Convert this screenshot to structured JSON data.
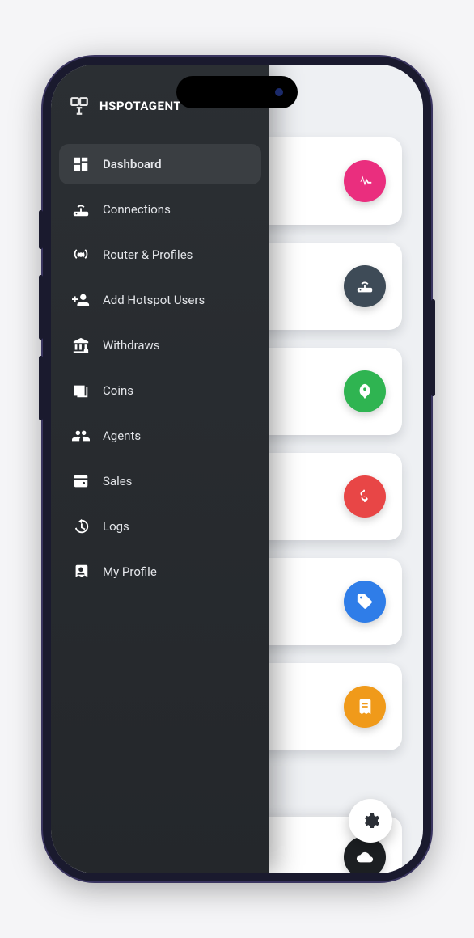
{
  "brand": {
    "title": "HSPOTAGENT"
  },
  "nav": {
    "items": [
      {
        "label": "Dashboard",
        "icon": "dashboard-icon",
        "active": true
      },
      {
        "label": "Connections",
        "icon": "router-icon",
        "active": false
      },
      {
        "label": "Router & Profiles",
        "icon": "broadcast-icon",
        "active": false
      },
      {
        "label": "Add Hotspot Users",
        "icon": "person-add-icon",
        "active": false
      },
      {
        "label": "Withdraws",
        "icon": "bank-icon",
        "active": false
      },
      {
        "label": "Coins",
        "icon": "coins-icon",
        "active": false
      },
      {
        "label": "Agents",
        "icon": "people-icon",
        "active": false
      },
      {
        "label": "Sales",
        "icon": "wallet-icon",
        "active": false
      },
      {
        "label": "Logs",
        "icon": "history-icon",
        "active": false
      },
      {
        "label": "My Profile",
        "icon": "badge-icon",
        "active": false
      }
    ]
  },
  "cards": [
    {
      "icon": "heartbeat-icon",
      "color": "b-pink"
    },
    {
      "icon": "router-icon",
      "color": "b-dark"
    },
    {
      "icon": "rocket-icon",
      "color": "b-green"
    },
    {
      "icon": "dollar-icon",
      "color": "b-red"
    },
    {
      "icon": "tag-icon",
      "color": "b-blue"
    },
    {
      "icon": "receipt-icon",
      "color": "b-orange"
    }
  ],
  "peek_card": {
    "icon": "cloud-icon",
    "color": "b-black"
  },
  "fab": {
    "icon": "gear-icon"
  }
}
